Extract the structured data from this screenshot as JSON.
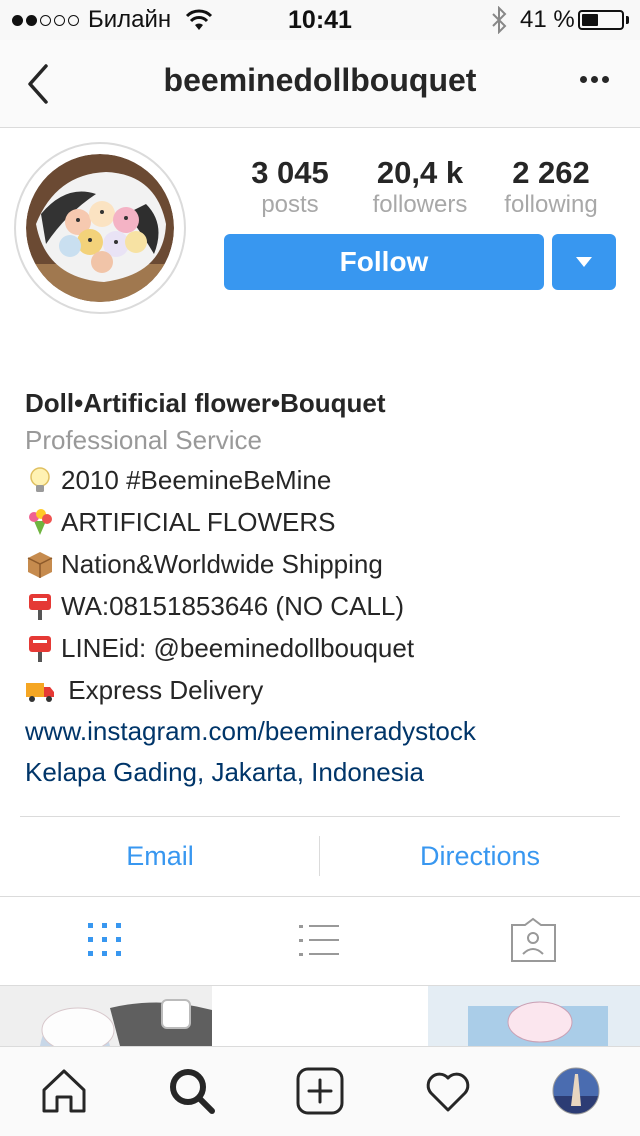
{
  "status_bar": {
    "carrier": "Билайн",
    "time": "10:41",
    "battery": "41 %",
    "battery_level": 0.41,
    "signal_bars": 2,
    "icons": [
      "wifi-icon",
      "bluetooth-icon",
      "battery-icon"
    ]
  },
  "nav": {
    "username": "beeminedollbouquet",
    "back_icon": "chevron-left-icon",
    "more_icon": "more-dots-icon"
  },
  "profile": {
    "stats": [
      {
        "value": "3 045",
        "label": "posts"
      },
      {
        "value": "20,4 k",
        "label": "followers"
      },
      {
        "value": "2 262",
        "label": "following"
      }
    ],
    "follow_label": "Follow",
    "dropdown_icon": "triangle-down-icon"
  },
  "bio": {
    "name": "Doll•Artificial flower•Bouquet",
    "category": "Professional Service",
    "lines": [
      {
        "icon": "lightbulb-icon",
        "text": "2010 #BeemineBeMine"
      },
      {
        "icon": "bouquet-icon",
        "text": "ARTIFICIAL FLOWERS"
      },
      {
        "icon": "package-icon",
        "text": "Nation&Worldwide Shipping"
      },
      {
        "icon": "mailbox-icon",
        "text": "WA:08151853646 (NO CALL)"
      },
      {
        "icon": "mailbox-icon",
        "text": "LINEid: @beeminedollbouquet"
      },
      {
        "icon": "delivery-truck-icon",
        "text": " Express Delivery"
      }
    ],
    "website": "www.instagram.com/beemineradystock",
    "location": "Kelapa Gading, Jakarta, Indonesia"
  },
  "actions": {
    "email": "Email",
    "directions": "Directions"
  },
  "tabs": {
    "icons": [
      "grid-view-icon",
      "list-view-icon",
      "tagged-photos-icon"
    ],
    "active": 0
  },
  "tab_bar": {
    "icons": [
      "home-icon",
      "search-icon",
      "new-post-icon",
      "activity-heart-icon",
      "profile-avatar-icon"
    ],
    "active": 1
  },
  "colors": {
    "accent": "#3897f0",
    "link": "#003569",
    "muted": "#a8a8a8"
  }
}
